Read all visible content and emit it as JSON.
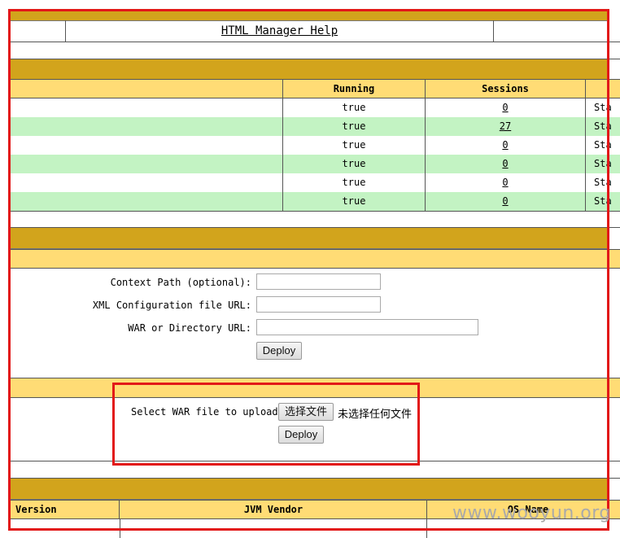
{
  "help_row": {
    "link": "HTML Manager Help"
  },
  "apps_table": {
    "headers": {
      "running": "Running",
      "sessions": "Sessions"
    },
    "rows": [
      {
        "running": "true",
        "sessions": "0",
        "status": "Sta"
      },
      {
        "running": "true",
        "sessions": "27",
        "status": "Sta"
      },
      {
        "running": "true",
        "sessions": "0",
        "status": "Sta"
      },
      {
        "running": "true",
        "sessions": "0",
        "status": "Sta"
      },
      {
        "running": "true",
        "sessions": "0",
        "status": "Sta"
      },
      {
        "running": "true",
        "sessions": "0",
        "status": "Sta"
      }
    ]
  },
  "deploy_form": {
    "context_path_label": "Context Path (optional):",
    "xml_config_label": "XML Configuration file URL:",
    "war_dir_label": "WAR or Directory URL:",
    "context_path_value": "",
    "xml_config_value": "",
    "war_dir_value": "",
    "deploy_button": "Deploy"
  },
  "upload_form": {
    "label": "Select WAR file to upload",
    "choose_button": "选择文件",
    "no_file_text": "未选择任何文件",
    "deploy_button": "Deploy"
  },
  "server_info": {
    "headers": {
      "version": "Version",
      "jvm_vendor": "JVM Vendor",
      "os_name": "OS Name"
    }
  },
  "watermark": "www.wooyun.org",
  "colors": {
    "section_band": "#d2a41c",
    "header_row": "#ffdc75",
    "alt_row": "#c3f3c3",
    "highlight_border": "#e21818"
  }
}
